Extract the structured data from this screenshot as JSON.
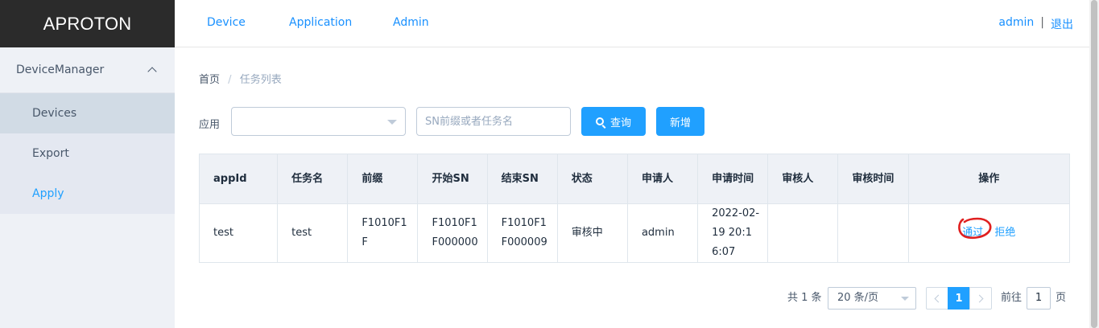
{
  "app": {
    "logo": "APROTON"
  },
  "topnav": [
    {
      "label": "Device"
    },
    {
      "label": "Application"
    },
    {
      "label": "Admin"
    }
  ],
  "user": {
    "name": "admin",
    "separator": "|",
    "logout": "退出"
  },
  "sidebar": {
    "group": "DeviceManager",
    "items": [
      {
        "label": "Devices"
      },
      {
        "label": "Export"
      },
      {
        "label": "Apply",
        "active": true
      }
    ]
  },
  "breadcrumb": {
    "home": "首页",
    "separator": "/",
    "current": "任务列表"
  },
  "filter": {
    "app_label": "应用",
    "app_value": "",
    "search_placeholder": "SN前缀或者任务名",
    "query_label": "查询",
    "new_label": "新增"
  },
  "table": {
    "headers": [
      "appId",
      "任务名",
      "前缀",
      "开始SN",
      "结束SN",
      "状态",
      "申请人",
      "申请时间",
      "审核人",
      "审核时间",
      "操作"
    ],
    "rows": [
      {
        "appId": "test",
        "task": "test",
        "prefix": "F1010F1F",
        "start_sn": "F1010F1F000000",
        "end_sn": "F1010F1F000009",
        "status": "审核中",
        "applicant": "admin",
        "apply_time": "2022-02-19 20:16:07",
        "reviewer": "",
        "review_time": "",
        "approve": "通过",
        "reject": "拒绝"
      }
    ]
  },
  "pagination": {
    "total": "共 1 条",
    "page_size": "20 条/页",
    "current_page": "1",
    "goto_label": "前往",
    "goto_value": "1",
    "page_suffix": "页"
  },
  "colors": {
    "accent": "#20a0ff",
    "logo_bg": "#2b2b2b",
    "sidebar_bg": "#eef1f6",
    "mark": "#e02020"
  },
  "icons": {
    "search": "search-icon",
    "collapse": "chevron-up-icon",
    "select": "caret-down-icon",
    "prev": "chevron-left-icon",
    "next": "chevron-right-icon"
  }
}
